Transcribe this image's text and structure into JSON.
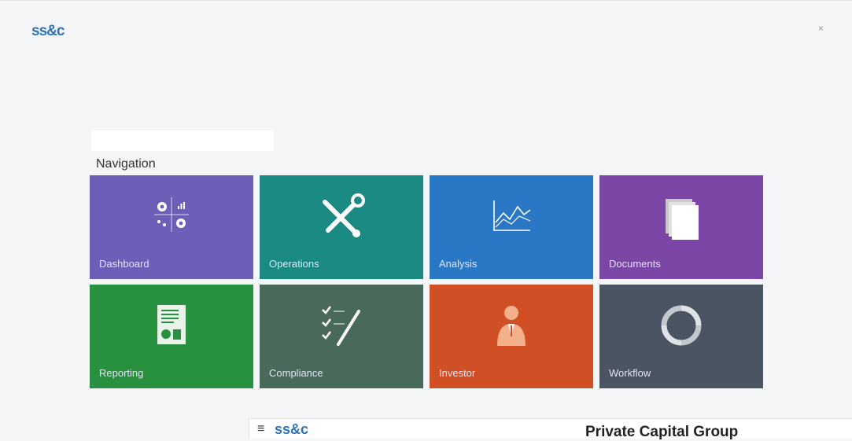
{
  "brand": {
    "logo": "ss&c"
  },
  "close": {
    "label": "×"
  },
  "nav": {
    "heading": "Navigation"
  },
  "tiles": [
    {
      "label": "Dashboard",
      "color": "#6b5fb8",
      "icon": "dashboard-icon"
    },
    {
      "label": "Operations",
      "color": "#1b8a82",
      "icon": "tools-icon"
    },
    {
      "label": "Analysis",
      "color": "#2a78c5",
      "icon": "line-chart-icon"
    },
    {
      "label": "Documents",
      "color": "#7b46a6",
      "icon": "documents-icon"
    },
    {
      "label": "Reporting",
      "color": "#27913f",
      "icon": "report-icon"
    },
    {
      "label": "Compliance",
      "color": "#496a5b",
      "icon": "checklist-icon"
    },
    {
      "label": "Investor",
      "color": "#d14f24",
      "icon": "investor-icon"
    },
    {
      "label": "Workflow",
      "color": "#4b5462",
      "icon": "workflow-icon"
    }
  ],
  "bottom": {
    "menu": "≡",
    "logo": "ss&c",
    "org": "Private Capital Group"
  }
}
